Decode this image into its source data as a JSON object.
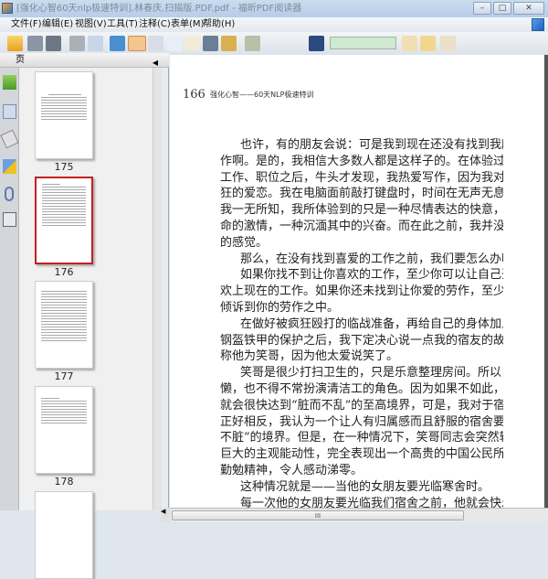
{
  "window": {
    "title": "[强化心智60天nlp极速特训].林春庆.扫描版.PDF.pdf - 福昕PDF阅读器",
    "minimize": "–",
    "maximize": "□",
    "close": "✕"
  },
  "menu": [
    "文件(F)",
    "编辑(E)",
    "视图(V)",
    "工具(T)",
    "注释(C)",
    "表单(M)",
    "帮助(H)"
  ],
  "panel": {
    "title": "页",
    "thumbnails": [
      {
        "page": "175"
      },
      {
        "page": "176",
        "selected": true
      },
      {
        "page": "177"
      },
      {
        "page": "178"
      }
    ]
  },
  "document": {
    "page_number": "166",
    "running_header": "强化心智——60天NLP极速特训",
    "paragraphs": [
      [
        "也许，有的朋友会说：可是我到现在还没有找到我所喜爱的工",
        "作啊。是的，我相信大多数人都是这样子的。在体验过各种各样的",
        "工作、职位之后，牛头才发现，我热爱写作，因为我对它有一种疯",
        "狂的爱恋。我在电脑面前敲打键盘时，时间在无声无息地流逝，而",
        "我一无所知，我所体验到的只是一种尽情表达的快意，一种点燃生",
        "命的激情，一种沉湎其中的兴奋。而在此之前，我并没有体验类似",
        "的感觉。"
      ],
      [
        "那么，在没有找到喜爱的工作之前，我们要怎么办呢？"
      ],
      [
        "如果你找不到让你喜欢的工作，至少你可以让自己开始学习喜",
        "欢上现在的工作。如果你还未找到让你爱的劳作，至少你可以把爱",
        "倾诉到你的劳作之中。"
      ],
      [
        "在做好被疯狂殴打的临战准备，再给自己的身体加上超强度的",
        "钢盔铁甲的保护之后，我下定决心说一点我的宿友的故事。这里，我",
        "称他为笑哥，因为他太爱说笑了。"
      ],
      [
        "笑哥是很少打扫卫生的，只是乐意整理房间。所以，虽然我很",
        "懒，也不得不常扮演清洁工的角色。因为如果不如此，我们的房间",
        "就会很快达到“脏而不乱”的至高境界，可是，我对于宿舍的标准",
        "正好相反，我认为一个让人有归属感而且舒服的宿舍要达到“乱而",
        "不脏”的境界。但是，在一种情况下，笑哥同志会突然转性，发挥",
        "巨大的主观能动性，完全表现出一个高贵的中国公民所必须具备的",
        "勤勉精神，令人感动涕零。"
      ],
      [
        "这种情况就是——当他的女朋友要光临寒舍时。"
      ],
      [
        "每一次他的女朋友要光临我们宿舍之前，他就会快乐地，无暇"
      ]
    ]
  },
  "scroll": {
    "grip": "III"
  }
}
